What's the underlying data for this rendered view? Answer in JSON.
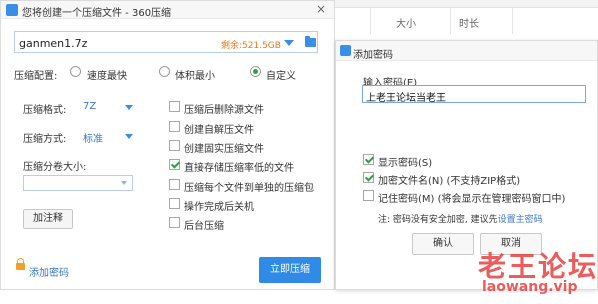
{
  "background": {
    "columns": [
      "大小",
      "时长"
    ]
  },
  "main_dialog": {
    "title": "您将创建一个压缩文件 - 360压缩",
    "close_glyph": "×",
    "path": {
      "value": "ganmen1.7z",
      "free_space": "剩余:521.5GB"
    },
    "config": {
      "label": "压缩配置:",
      "options": [
        "速度最快",
        "体积最小",
        "自定义"
      ],
      "selected": "自定义"
    },
    "format": {
      "label": "压缩格式:",
      "value": "7Z"
    },
    "method": {
      "label": "压缩方式:",
      "value": "标准"
    },
    "split": {
      "label": "压缩分卷大小:",
      "value": ""
    },
    "note_button": "加注释",
    "options": [
      {
        "label": "压缩后删除源文件",
        "checked": false
      },
      {
        "label": "创建自解压文件",
        "checked": false
      },
      {
        "label": "创建固实压缩文件",
        "checked": false
      },
      {
        "label": "直接存储压缩率低的文件",
        "checked": true
      },
      {
        "label": "压缩每个文件到单独的压缩包",
        "checked": false
      },
      {
        "label": "操作完成后关机",
        "checked": false
      },
      {
        "label": "后台压缩",
        "checked": false
      }
    ],
    "add_password_link": "添加密码",
    "compress_button": "立即压缩"
  },
  "password_dialog": {
    "title": "添加密码",
    "input_label": "输入密码(E)",
    "input_value": "上老王论坛当老王",
    "options": [
      {
        "label": "显示密码(S)",
        "checked": true
      },
      {
        "label": "加密文件名(N) (不支持ZIP格式)",
        "checked": true
      },
      {
        "label": "记住密码(M) (将会显示在管理密码窗口中)",
        "checked": false
      }
    ],
    "note_prefix": "注: 密码没有安全加密, 建议先",
    "note_link": "设置主密码",
    "ok_button": "确认",
    "cancel_button": "取消"
  },
  "watermark": {
    "cn": "老王论坛",
    "en": "laowang.vip"
  },
  "colors": {
    "accent_blue": "#2f8be6",
    "link_blue": "#3a76c4",
    "free_space_orange": "#ee7a1c",
    "check_green": "#2f9e44",
    "watermark_red": "#e84040"
  }
}
